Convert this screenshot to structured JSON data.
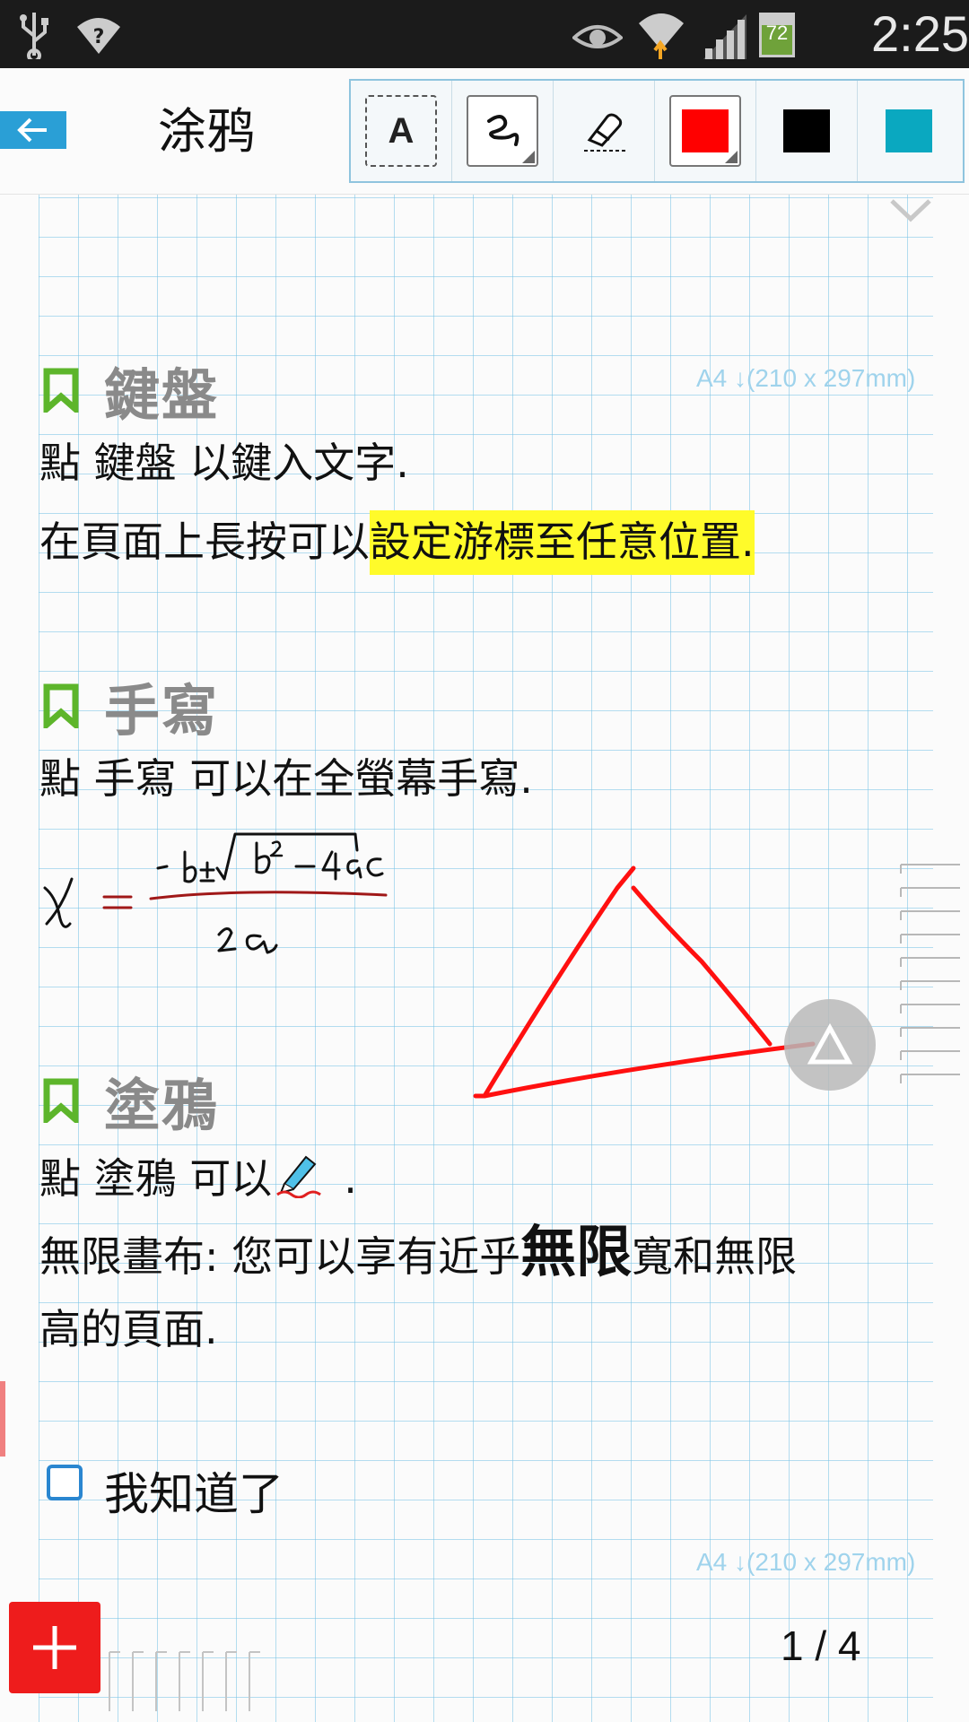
{
  "status_bar": {
    "time": "2:25 PM",
    "battery": "72",
    "icons": [
      "usb-icon",
      "wifi-question-icon",
      "eye-icon",
      "wifi-icon",
      "signal-icon",
      "battery-icon"
    ]
  },
  "app_bar": {
    "title": "涂鸦",
    "tools": {
      "text_tool_label": "A",
      "icons": [
        "text-tool-icon",
        "pen-tool-icon",
        "eraser-icon"
      ],
      "colors": [
        "#ff0000",
        "#000000",
        "#0aa8c0"
      ]
    }
  },
  "page": {
    "size_label": "A4 ↓(210 x 297mm)",
    "sections": [
      {
        "heading": "鍵盤",
        "lines": [
          "點 鍵盤 以鍵入文字.",
          "在頁面上長按可以",
          "設定游標至任意位置."
        ]
      },
      {
        "heading": "手寫",
        "lines": [
          "點 手寫 可以在全螢幕手寫."
        ]
      },
      {
        "heading": "塗鴉",
        "lines": [
          "點 塗鴉 可以",
          ".",
          "無限畫布: 您可以享有近乎",
          "無限",
          "寬和無限",
          "高的頁面."
        ]
      }
    ],
    "checkbox_label": "我知道了",
    "page_indicator": "1 / 4"
  },
  "colors": {
    "accent_blue": "#2a9fd6",
    "grid": "#78c3e6",
    "highlight": "#fffb2a",
    "bookmark_green": "#5db52b",
    "add_button": "#ee1c1c"
  }
}
